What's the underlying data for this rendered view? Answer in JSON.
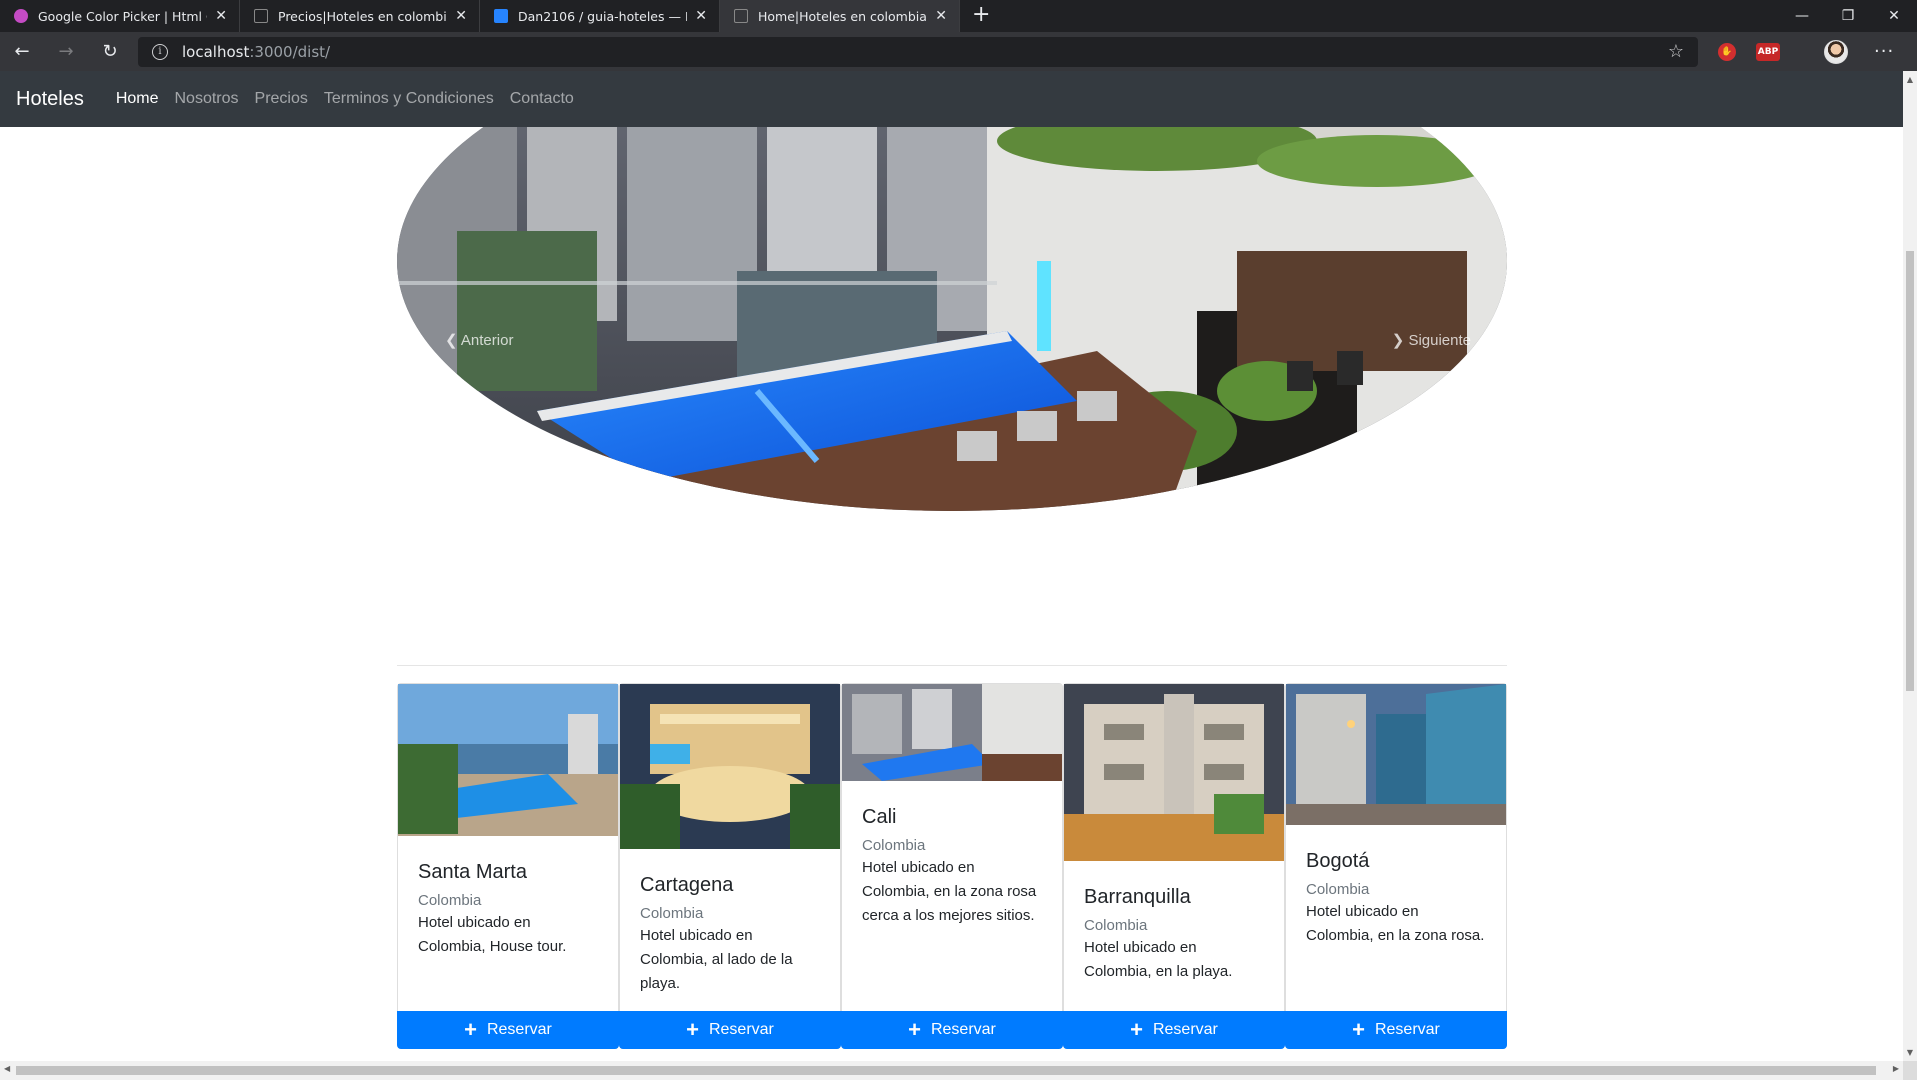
{
  "browser": {
    "tabs": [
      {
        "title": "Google Color Picker | Html Color",
        "icon": "color-picker-favicon",
        "active": false
      },
      {
        "title": "Precios|Hoteles en colombia",
        "icon": "page-favicon",
        "active": false
      },
      {
        "title": "Dan2106 / guia-hoteles — Bitbu",
        "icon": "bitbucket-favicon",
        "active": false
      },
      {
        "title": "Home|Hoteles en colombia",
        "icon": "page-favicon",
        "active": true
      }
    ],
    "url_host": "localhost",
    "url_path": ":3000/dist/",
    "ext_abp": "ABP"
  },
  "site": {
    "brand": "Hoteles",
    "nav": [
      "Home",
      "Nosotros",
      "Precios",
      "Terminos y Condiciones",
      "Contacto"
    ],
    "carousel": {
      "prev": "Anterior",
      "next": "Siguiente"
    },
    "cards": [
      {
        "title": "Santa Marta",
        "subtitle": "Colombia",
        "text": "Hotel ubicado en Colombia, House tour.",
        "button": "Reservar"
      },
      {
        "title": "Cartagena",
        "subtitle": "Colombia",
        "text": "Hotel ubicado en Colombia, al lado de la playa.",
        "button": "Reservar"
      },
      {
        "title": "Cali",
        "subtitle": "Colombia",
        "text": "Hotel ubicado en Colombia, en la zona rosa cerca a los mejores sitios.",
        "button": "Reservar"
      },
      {
        "title": "Barranquilla",
        "subtitle": "Colombia",
        "text": "Hotel ubicado en Colombia, en la playa.",
        "button": "Reservar"
      },
      {
        "title": "Bogotá",
        "subtitle": "Colombia",
        "text": "Hotel ubicado en Colombia, en la zona rosa.",
        "button": "Reservar"
      }
    ]
  },
  "colors": {
    "navbar": "#343a40",
    "primary": "#007bff",
    "muted": "#6c757d"
  }
}
